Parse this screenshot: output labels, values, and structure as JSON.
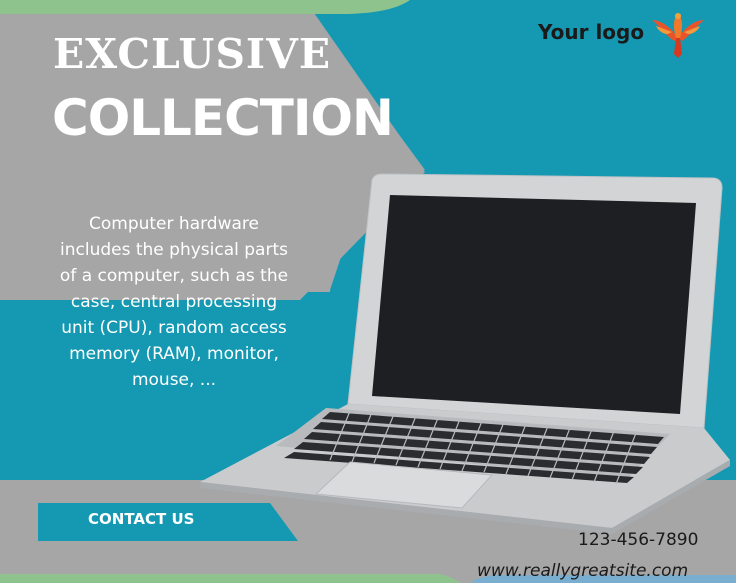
{
  "colors": {
    "background_gray": "#a6a6a7",
    "teal": "#1599b3",
    "dark_teal": "#0f6f87",
    "green_accent": "#8fc38e",
    "text_white": "#ffffff",
    "text_dark": "#1a1a1a"
  },
  "brand": {
    "logo_text": "Your logo",
    "logo_icon": "phoenix-bird-icon"
  },
  "headline": {
    "line1": "EXCLUSIVE",
    "line2": "COLLECTION"
  },
  "description": "Computer hardware includes the physical parts of a computer, such as the case, central processing unit (CPU), random access memory (RAM), monitor, mouse, ...",
  "cta": {
    "label": "CONTACT US"
  },
  "contact": {
    "phone": "123-456-7890",
    "website": "www.reallygreatsite.com"
  },
  "product_image": {
    "icon": "laptop-illustration"
  }
}
